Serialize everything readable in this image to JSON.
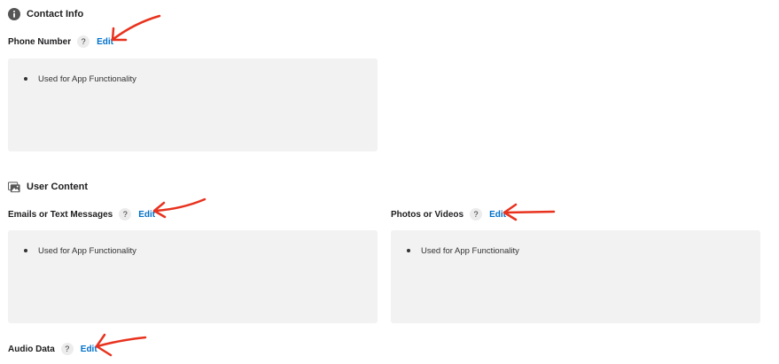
{
  "contact": {
    "title": "Contact Info",
    "icon": "info-circle-icon",
    "phone": {
      "label": "Phone Number",
      "help": "?",
      "edit": "Edit",
      "purposes": [
        "Used for App Functionality"
      ]
    }
  },
  "user_content": {
    "title": "User Content",
    "icon": "photos-icon",
    "emails": {
      "label": "Emails or Text Messages",
      "help": "?",
      "edit": "Edit",
      "purposes": [
        "Used for App Functionality"
      ]
    },
    "photos": {
      "label": "Photos or Videos",
      "help": "?",
      "edit": "Edit",
      "purposes": [
        "Used for App Functionality"
      ]
    },
    "audio": {
      "label": "Audio Data",
      "help": "?",
      "edit": "Edit"
    }
  },
  "colors": {
    "accent": "#0070c9",
    "annotation": "#e8321e",
    "box": "#f2f2f2"
  }
}
